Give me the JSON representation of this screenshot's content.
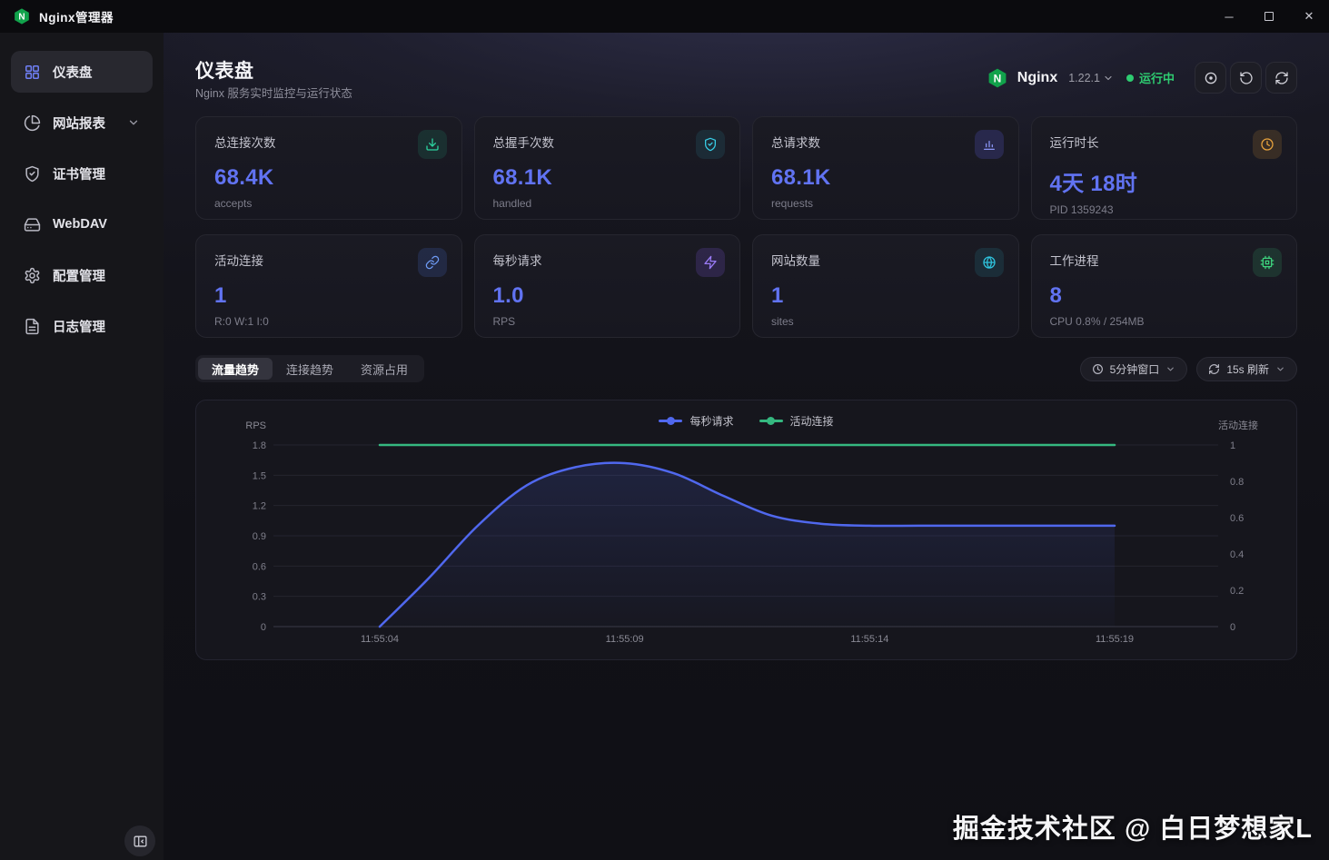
{
  "titlebar": {
    "app_title": "Nginx管理器",
    "window_controls": {
      "minimize": "─",
      "maximize": "",
      "close": "✕"
    }
  },
  "sidebar": {
    "items": [
      {
        "label": "仪表盘",
        "icon": "dashboard-grid-icon",
        "active": true,
        "has_chevron": false
      },
      {
        "label": "网站报表",
        "icon": "pie-chart-icon",
        "active": false,
        "has_chevron": true
      },
      {
        "label": "证书管理",
        "icon": "shield-check-icon",
        "active": false,
        "has_chevron": false
      },
      {
        "label": "WebDAV",
        "icon": "hard-drive-icon",
        "active": false,
        "has_chevron": false
      },
      {
        "label": "配置管理",
        "icon": "gear-icon",
        "active": false,
        "has_chevron": false
      },
      {
        "label": "日志管理",
        "icon": "file-text-icon",
        "active": false,
        "has_chevron": false
      }
    ]
  },
  "header": {
    "title": "仪表盘",
    "subtitle": "Nginx 服务实时监控与运行状态",
    "service": {
      "name": "Nginx",
      "version": "1.22.1",
      "status": "运行中",
      "status_color": "#2ecc71"
    },
    "actions": [
      {
        "name": "power-button",
        "icon": "circle-dot-icon"
      },
      {
        "name": "restart-button",
        "icon": "rotate-ccw-icon"
      },
      {
        "name": "reload-button",
        "icon": "refresh-cw-icon"
      }
    ]
  },
  "stats": [
    {
      "title": "总连接次数",
      "value": "68.4K",
      "sub": "accepts",
      "icon": "download-icon",
      "icon_color": "#2dd4a0",
      "icon_bg": "rgba(45,212,160,0.12)"
    },
    {
      "title": "总握手次数",
      "value": "68.1K",
      "sub": "handled",
      "icon": "shield-check-icon",
      "icon_color": "#38cfe8",
      "icon_bg": "rgba(56,207,232,0.10)"
    },
    {
      "title": "总请求数",
      "value": "68.1K",
      "sub": "requests",
      "icon": "bar-chart-icon",
      "icon_color": "#8b96f8",
      "icon_bg": "rgba(99,102,241,0.20)"
    },
    {
      "title": "运行时长",
      "value": "4天 18时",
      "sub": "PID 1359243",
      "icon": "clock-icon",
      "icon_color": "#e8a33d",
      "icon_bg": "rgba(232,163,61,0.15)"
    },
    {
      "title": "活动连接",
      "value": "1",
      "sub": "R:0 W:1 I:0",
      "icon": "link-icon",
      "icon_color": "#6e9bf5",
      "icon_bg": "rgba(90,130,245,0.16)"
    },
    {
      "title": "每秒请求",
      "value": "1.0",
      "sub": "RPS",
      "icon": "zap-icon",
      "icon_color": "#9a7bf7",
      "icon_bg": "rgba(139,92,246,0.18)"
    },
    {
      "title": "网站数量",
      "value": "1",
      "sub": "sites",
      "icon": "globe-icon",
      "icon_color": "#2fc4de",
      "icon_bg": "rgba(47,196,222,0.12)"
    },
    {
      "title": "工作进程",
      "value": "8",
      "sub": "CPU 0.8% / 254MB",
      "icon": "cpu-icon",
      "icon_color": "#3ed47e",
      "icon_bg": "rgba(62,212,126,0.14)"
    }
  ],
  "tabs": {
    "items": [
      "流量趋势",
      "连接趋势",
      "资源占用"
    ],
    "active_index": 0
  },
  "controls": {
    "time_window": {
      "label": "5分钟窗口",
      "icon": "clock-icon"
    },
    "refresh": {
      "label": "15s 刷新",
      "icon": "refresh-cw-icon"
    }
  },
  "chart_data": {
    "type": "line",
    "x_seconds": [
      4,
      5,
      6,
      7,
      8,
      9,
      10,
      11,
      12,
      13,
      14,
      15,
      16,
      17,
      18,
      19
    ],
    "x_tick_seconds": [
      4,
      9,
      14,
      19
    ],
    "x_tick_labels": [
      "11:55:04",
      "11:55:09",
      "11:55:14",
      "11:55:19"
    ],
    "series": [
      {
        "name": "每秒请求",
        "axis": "left",
        "color": "#5068ee",
        "values": [
          0,
          0.48,
          1.0,
          1.4,
          1.58,
          1.62,
          1.52,
          1.3,
          1.1,
          1.02,
          1.0,
          1.0,
          1.0,
          1.0,
          1.0,
          1.0
        ],
        "area": true
      },
      {
        "name": "活动连接",
        "axis": "right",
        "color": "#35b880",
        "values": [
          1,
          1,
          1,
          1,
          1,
          1,
          1,
          1,
          1,
          1,
          1,
          1,
          1,
          1,
          1,
          1
        ],
        "area": false
      }
    ],
    "left_axis": {
      "label": "RPS",
      "min": 0,
      "max": 1.8,
      "ticks": [
        1.8,
        1.5,
        1.2,
        0.9,
        0.6,
        0.3,
        0
      ]
    },
    "right_axis": {
      "label": "活动连接",
      "min": 0,
      "max": 1,
      "ticks": [
        1,
        0.8,
        0.6,
        0.4,
        0.2,
        0
      ]
    },
    "grid": true,
    "legend_position": "top-center"
  },
  "watermark": "掘金技术社区 @ 白日梦想家L"
}
